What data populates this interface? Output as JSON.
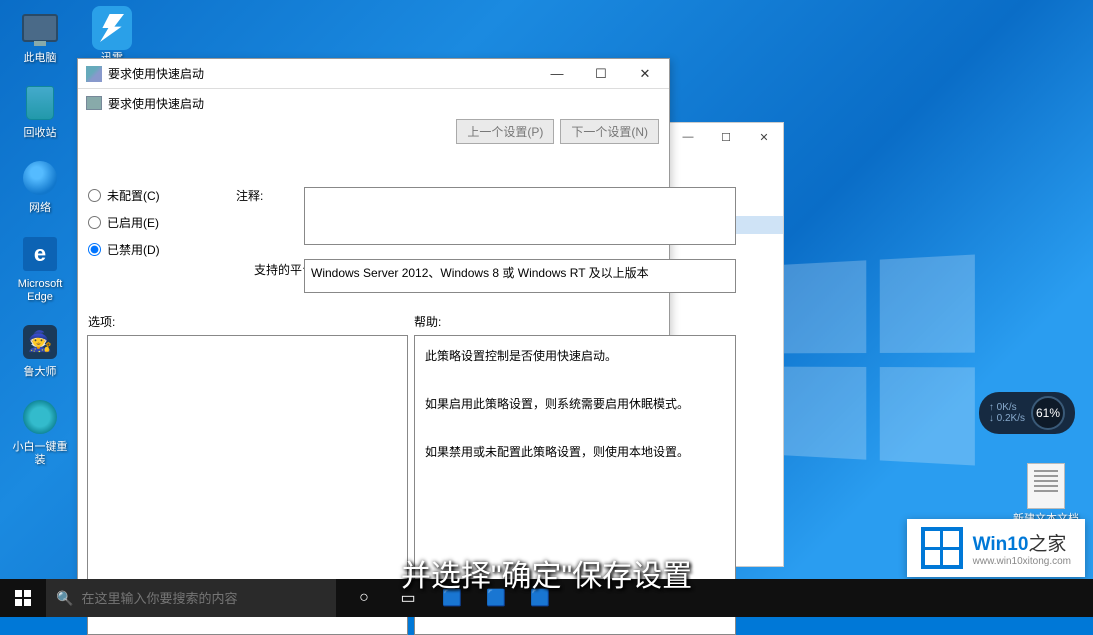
{
  "desktop": {
    "icons": [
      {
        "name": "my-computer",
        "label": "此电脑"
      },
      {
        "name": "recycle-bin",
        "label": "回收站"
      },
      {
        "name": "network",
        "label": "网络"
      },
      {
        "name": "microsoft-edge",
        "label": "Microsoft Edge"
      },
      {
        "name": "ludashi",
        "label": "鲁大师"
      },
      {
        "name": "xiaobai-reinstall",
        "label": "小白一键重装"
      }
    ],
    "xunlei_label": "迅雷",
    "txtfile_label": "新建文本文档"
  },
  "netwidget": {
    "up": "0K/s",
    "down": "0.2K/s",
    "percent": "61%"
  },
  "bgwin": {
    "minimize": "—",
    "maximize": "☐",
    "close": "✕"
  },
  "policywin": {
    "title": "要求使用快速启动",
    "subtitle": "要求使用快速启动",
    "prev_btn": "上一个设置(P)",
    "next_btn": "下一个设置(N)",
    "minimize": "—",
    "maximize": "☐",
    "close": "✕",
    "radio_notconfig": "未配置(C)",
    "radio_enabled": "已启用(E)",
    "radio_disabled": "已禁用(D)",
    "comment_label": "注释:",
    "platform_label": "支持的平台:",
    "platform_text": "Windows Server 2012、Windows 8 或 Windows RT 及以上版本",
    "options_label": "选项:",
    "help_label": "帮助:",
    "help_line1": "此策略设置控制是否使用快速启动。",
    "help_line2": "如果启用此策略设置，则系统需要启用休眠模式。",
    "help_line3": "如果禁用或未配置此策略设置，则使用本地设置。"
  },
  "taskbar": {
    "search_placeholder": "在这里输入你要搜索的内容"
  },
  "subtitle": "并选择\"确定\"保存设置",
  "watermark": {
    "brand1": "Win10",
    "brand2": "之家",
    "url": "www.win10xitong.com"
  }
}
